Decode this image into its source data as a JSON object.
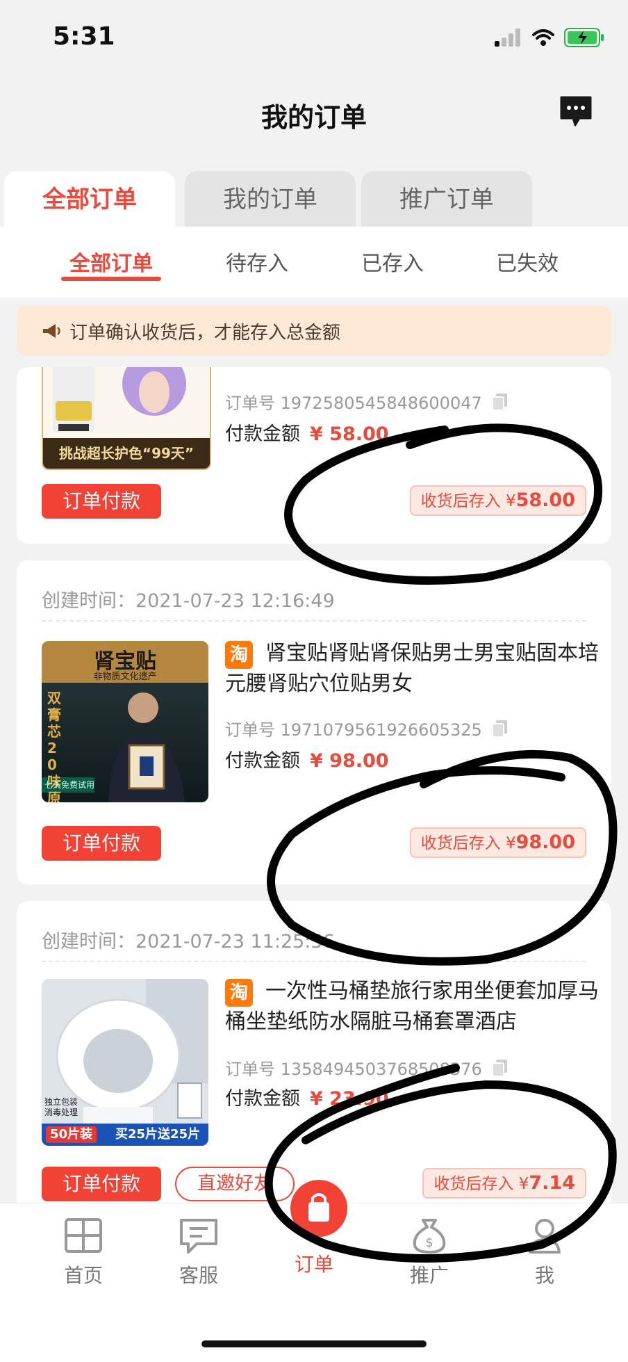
{
  "status": {
    "time": "5:31"
  },
  "nav": {
    "title": "我的订单"
  },
  "top_tabs": [
    "全部订单",
    "我的订单",
    "推广订单"
  ],
  "sub_tabs": [
    "全部订单",
    "待存入",
    "已存入",
    "已失效"
  ],
  "notice": "订单确认收货后，才能存入总金额",
  "orders": [
    {
      "image_caption": "挑战超长护色“99天”",
      "order_no": "订单号 1972580545848600047",
      "paid_label": "付款金额",
      "paid_amount": "¥ 58.00",
      "pay_button": "订单付款",
      "store_label": "收货后存入 ¥",
      "store_amount": "58.00"
    },
    {
      "created": "创建时间：2021-07-23 12:16:49",
      "platform_badge": "淘",
      "title": "肾宝贴肾贴肾保贴男士男宝贴固本培元腰肾贴穴位贴男女",
      "image_text": {
        "head": "肾宝贴",
        "sub": "非物质文化遗产",
        "side": "双膏芯20味原料",
        "trial": "七天免费试用"
      },
      "order_no": "订单号 1971079561926605325",
      "paid_label": "付款金额",
      "paid_amount": "¥ 98.00",
      "pay_button": "订单付款",
      "store_label": "收货后存入 ¥",
      "store_amount": "98.00"
    },
    {
      "created": "创建时间：2021-07-23 11:25:56",
      "platform_badge": "淘",
      "title": "一次性马桶垫旅行家用坐便套加厚马桶坐垫纸防水隔脏马桶套罩酒店",
      "image_text": {
        "corner": "独立包装 消毒处理",
        "tag1": "50片装",
        "tag2": "买25片送25片"
      },
      "order_no": "订单号 1358494503768508376",
      "paid_label": "付款金额",
      "paid_amount": "¥ 23.90",
      "pay_button": "订单付款",
      "invite_button": "直邀好友",
      "store_label": "收货后存入 ¥",
      "store_amount": "7.14"
    }
  ],
  "bottom_nav": [
    {
      "label": "首页",
      "icon": "grid-icon"
    },
    {
      "label": "客服",
      "icon": "chat-icon"
    },
    {
      "label": "订单",
      "icon": "bag-icon"
    },
    {
      "label": "推广",
      "icon": "money-bag-icon"
    },
    {
      "label": "我",
      "icon": "person-icon"
    }
  ],
  "colors": {
    "accent": "#e84a3c",
    "button": "#f24236",
    "notice_bg": "#fde9d5",
    "page_bg": "#f2f2f2"
  }
}
